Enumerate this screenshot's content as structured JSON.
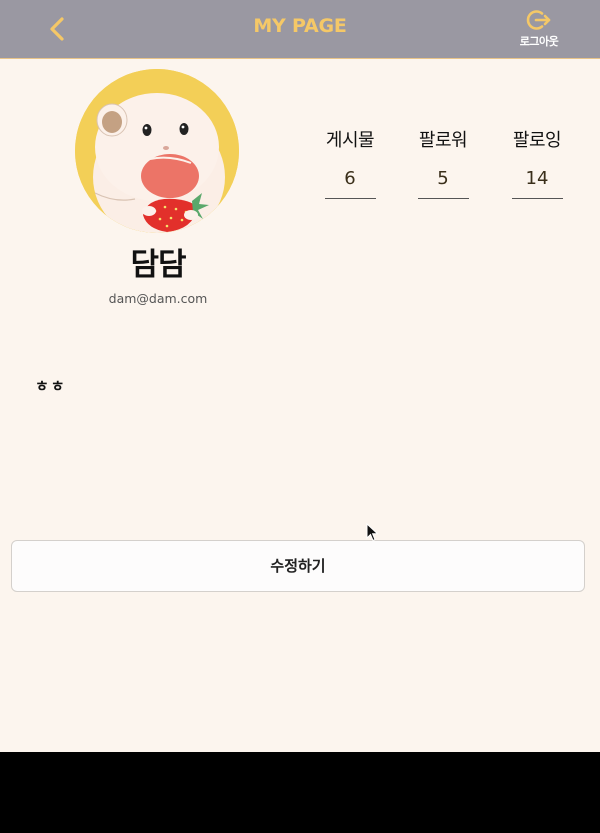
{
  "header": {
    "title": "MY PAGE",
    "back_icon": "chevron-left-icon",
    "logout_icon": "logout-icon",
    "logout_label": "로그아웃"
  },
  "profile": {
    "avatar": "hamster-with-strawberry-avatar",
    "nickname": "담담",
    "email": "dam@dam.com",
    "bio": "ㅎㅎ"
  },
  "stats": [
    {
      "label": "게시물",
      "value": "6"
    },
    {
      "label": "팔로워",
      "value": "5"
    },
    {
      "label": "팔로잉",
      "value": "14"
    }
  ],
  "actions": {
    "edit_label": "수정하기"
  },
  "colors": {
    "header_bg": "#9a98a2",
    "accent": "#f5c867",
    "page_bg": "#fcf5ee",
    "avatar_bg": "#f3cf57"
  }
}
